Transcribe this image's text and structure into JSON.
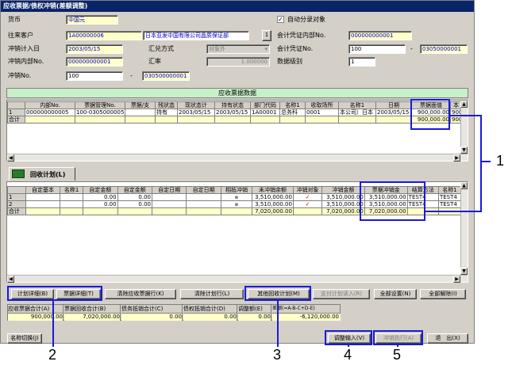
{
  "window": {
    "title": "应收票据/债权冲销(差额调整)"
  },
  "form": {
    "currency_label": "货币",
    "currency_value": "中国元",
    "auto_label": "自动分录对象",
    "auto_checked": "✓",
    "customer_label": "往来客户",
    "customer_code": "1A00000006",
    "customer_name": "日本亚发中国有限公司晶质保证部",
    "lookup_btn": "1",
    "voucher_internal_label": "会计凭证内部No.",
    "voucher_internal_value": "000000000001",
    "offset_date_label": "冲销计入日",
    "offset_date_value": "2003/05/15",
    "remit_label": "汇兑方式",
    "remit_value": "对象外",
    "voucher_no_label": "会计凭证No.",
    "voucher_no_from": "100",
    "voucher_no_sep": "-",
    "voucher_no_to": "03050000001",
    "offset_internal_label": "冲销内部No.",
    "offset_internal_value": "000000000001",
    "rate_label": "汇率",
    "rate_value": "1.000000",
    "data_level_label": "数据级别",
    "data_level_value": "1",
    "offset_no_label": "冲销No.",
    "offset_no_from": "100",
    "offset_no_sep": "-",
    "offset_no_to": "030500000001"
  },
  "notes_grid": {
    "title": "应收票据数据",
    "columns": [
      "内部No.",
      "票据管理No.",
      "票据/支",
      "残状态",
      "现状态计",
      "持有状态",
      "部门代码",
      "名称1",
      "收取场所",
      "名称1",
      "日期",
      "票据面值",
      "本"
    ],
    "rows": [
      [
        "1",
        "000000000005",
        "100-0305000005",
        "",
        "持有",
        "2003/05/15",
        "2003/05/15",
        "1A00001",
        "总务科",
        "0001",
        "本公司）日本",
        "2003/05/15",
        "900,000.00",
        "900"
      ]
    ],
    "total_label": "合计",
    "total_value": "900,000.00",
    "total_tail": "900"
  },
  "tab": {
    "label": "回收计划(L)"
  },
  "plan_grid": {
    "columns": [
      "",
      "自定基本",
      "名称1",
      "自定金额",
      "自定金额",
      "自定日期",
      "自定日期",
      "相抵冲销",
      "未冲销余额",
      "冲销对象",
      "冲销金额",
      "票据冲销金",
      "结算方法",
      "名称1"
    ],
    "rows": [
      [
        "1",
        "",
        "",
        "0.00",
        "0.00",
        "",
        "",
        "▪",
        "3,510,000.00",
        "✓",
        "3,510,000.00",
        "3,510,000.00",
        "TEST4",
        "TEST4"
      ],
      [
        "2",
        "",
        "",
        "0.00",
        "0.00",
        "",
        "",
        "▪",
        "3,510,000.00",
        "✓",
        "3,510,000.00",
        "3,510,000.00",
        "TEST4",
        "TEST4"
      ]
    ],
    "total_label": "合计",
    "total_unoffset": "7,020,000.00",
    "total_offset": "7,020,000.00",
    "total_note": "7,020,000.00"
  },
  "buttons": {
    "plan_detail": "计划详细(B)",
    "note_detail": "票据详细(T)",
    "clear_receivable": "清除应收票据行(K)",
    "clear_plan": "清除计划行(L)",
    "other_plan": "其他回收计划(M)",
    "pay_plan_read": "支付计划读入(R)",
    "all_set": "全部设置(N)",
    "all_clear": "全部解除(I)",
    "name_switch": "名称切换(J)",
    "adjust_input": "调整输入(V)",
    "offset_exec": "冲销执行(A)",
    "exit": "退　出(X)"
  },
  "summary": {
    "headers": [
      "应收票据合计(A)",
      "票据回收合计(B)",
      "债务抵销合计(C)",
      "债权抵销合计(D)",
      "调整额(E)",
      "差额(=A-B-C+D-E)"
    ],
    "values": [
      "900,000.00",
      "7,020,000.00",
      "0.00",
      "0.00",
      "0.00",
      "-6,120,000.00"
    ]
  },
  "callouts": [
    "1",
    "2",
    "3",
    "4",
    "5"
  ]
}
